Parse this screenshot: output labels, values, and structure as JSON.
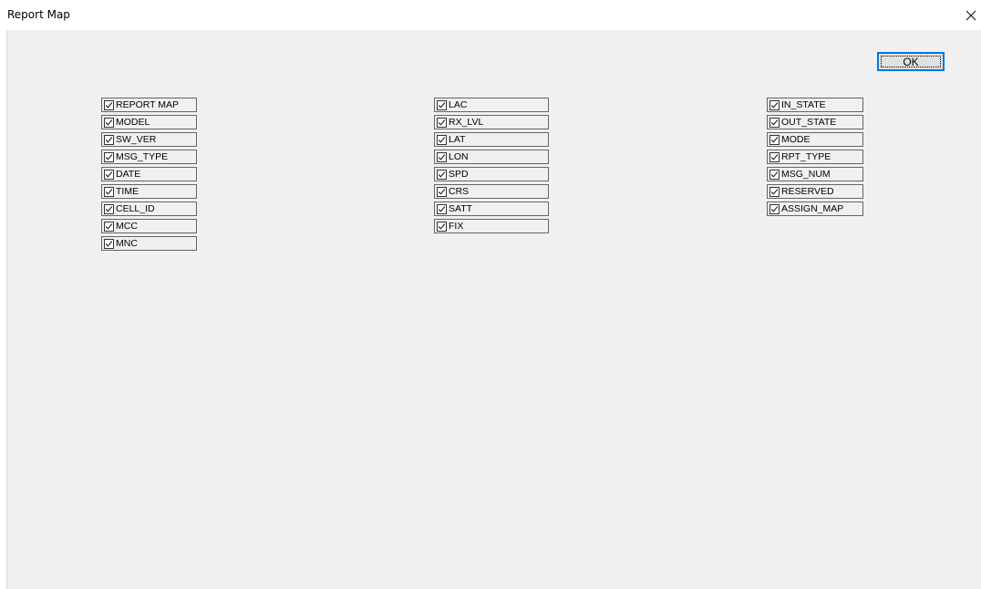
{
  "window": {
    "title": "Report Map",
    "ok_label": "OK"
  },
  "columns": [
    {
      "items": [
        {
          "label": "REPORT MAP",
          "checked": true
        },
        {
          "label": "MODEL",
          "checked": true
        },
        {
          "label": "SW_VER",
          "checked": true
        },
        {
          "label": "MSG_TYPE",
          "checked": true
        },
        {
          "label": "DATE",
          "checked": true
        },
        {
          "label": "TIME",
          "checked": true
        },
        {
          "label": "CELL_ID",
          "checked": true
        },
        {
          "label": "MCC",
          "checked": true
        },
        {
          "label": "MNC",
          "checked": true
        }
      ]
    },
    {
      "items": [
        {
          "label": "LAC",
          "checked": true
        },
        {
          "label": "RX_LVL",
          "checked": true
        },
        {
          "label": "LAT",
          "checked": true
        },
        {
          "label": "LON",
          "checked": true
        },
        {
          "label": "SPD",
          "checked": true
        },
        {
          "label": "CRS",
          "checked": true
        },
        {
          "label": "SATT",
          "checked": true
        },
        {
          "label": "FIX",
          "checked": true
        }
      ]
    },
    {
      "items": [
        {
          "label": "IN_STATE",
          "checked": true
        },
        {
          "label": "OUT_STATE",
          "checked": true
        },
        {
          "label": "MODE",
          "checked": true
        },
        {
          "label": "RPT_TYPE",
          "checked": true
        },
        {
          "label": "MSG_NUM",
          "checked": true
        },
        {
          "label": "RESERVED",
          "checked": true
        },
        {
          "label": "ASSIGN_MAP",
          "checked": true
        }
      ]
    }
  ]
}
